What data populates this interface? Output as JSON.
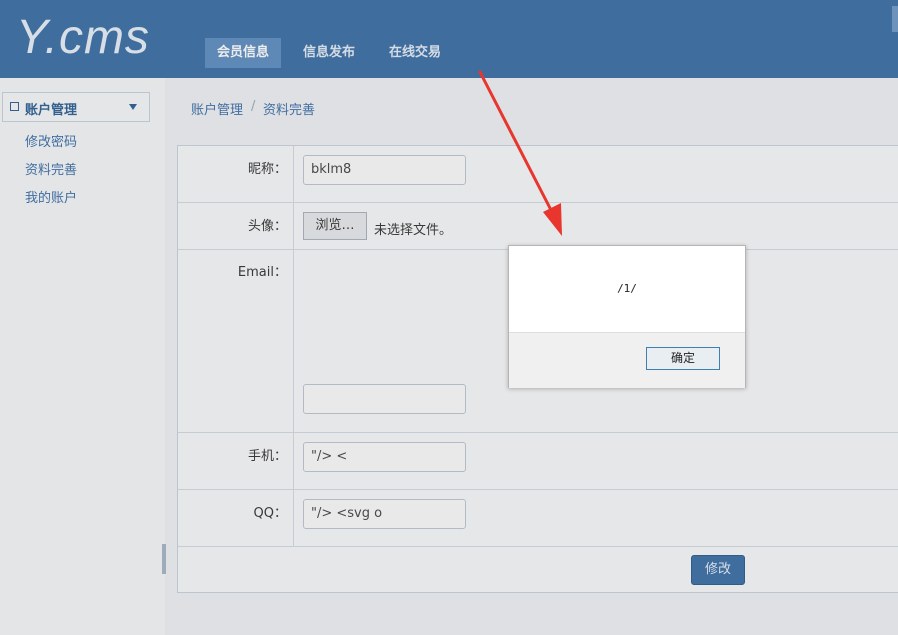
{
  "header": {
    "logo": "Y.cms",
    "nav": [
      {
        "label": "会员信息",
        "active": true
      },
      {
        "label": "信息发布",
        "active": false
      },
      {
        "label": "在线交易",
        "active": false
      }
    ]
  },
  "sidebar": {
    "section_title": "账户管理",
    "links": [
      "修改密码",
      "资料完善",
      "我的账户"
    ]
  },
  "breadcrumb": {
    "root": "账户管理",
    "separator": "/",
    "current": "资料完善"
  },
  "form": {
    "nickname": {
      "label": "昵称：",
      "value": "bklm8"
    },
    "avatar": {
      "label": "头像：",
      "button": "浏览…",
      "status": "未选择文件。"
    },
    "email": {
      "label": "Email：",
      "value": ""
    },
    "phone": {
      "label": "手机：",
      "value": "\"/> <"
    },
    "qq": {
      "label": "QQ：",
      "value": "\"/> <svg o"
    },
    "submit": "修改"
  },
  "dialog": {
    "message": "/1/",
    "ok": "确定"
  },
  "colors": {
    "header": "#3a6ea5",
    "arrow": "#e8352e"
  }
}
